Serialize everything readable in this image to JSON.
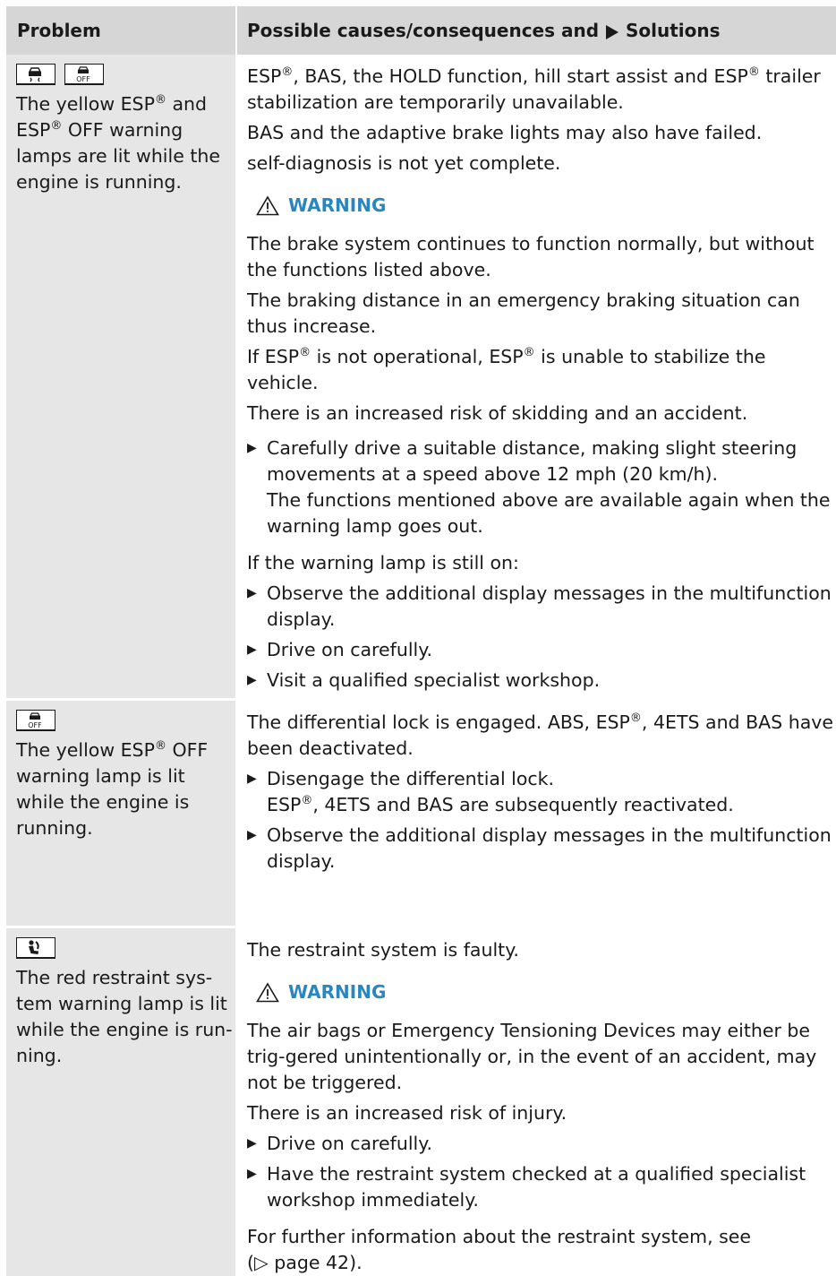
{
  "header": {
    "problem": "Problem",
    "solutions_prefix": "Possible causes/consequences and",
    "solutions_suffix": "Solutions"
  },
  "rows": [
    {
      "icons": [
        "esp-warning-lamp-icon",
        "esp-off-warning-lamp-icon"
      ],
      "problem": [
        "The yellow ESP",
        "®",
        " and ESP",
        "®",
        " OFF warning lamps are lit while the engine is running."
      ],
      "cause_1": [
        "ESP",
        "®",
        ", BAS, the HOLD function, hill start assist and ESP",
        "®",
        " trailer stabilization are temporarily unavailable."
      ],
      "cause_2": "BAS and the adaptive brake lights may also have failed.",
      "cause_3": "self-diagnosis is not yet complete.",
      "warning_label": "WARNING",
      "warning_1": "The brake system continues to function normally, but without the functions listed above.",
      "warning_2": "The braking distance in an emergency braking situation can thus increase.",
      "warning_3": [
        "If ESP",
        "®",
        " is not operational, ESP",
        "®",
        " is unable to stabilize the vehicle."
      ],
      "warning_4": "There is an increased risk of skidding and an accident.",
      "action_1": "Carefully drive a suitable distance, making slight steering movements at a speed above 12 mph (20 km/h).",
      "action_1_note": "The functions mentioned above are available again when the warning lamp goes out.",
      "if_still_on": "If the warning lamp is still on:",
      "action_2": "Observe the additional display messages in the multifunction display.",
      "action_3": "Drive on carefully.",
      "action_4": "Visit a qualified specialist workshop."
    },
    {
      "icons": [
        "esp-off-warning-lamp-icon"
      ],
      "problem": [
        "The yellow ESP",
        "®",
        " OFF warning lamp is lit while the engine is running."
      ],
      "cause_1": [
        "The differential lock is engaged. ABS, ESP",
        "®",
        ", 4ETS and BAS have been deactivated."
      ],
      "action_1": "Disengage the differential lock.",
      "action_1_note": [
        "ESP",
        "®",
        ", 4ETS and BAS are subsequently reactivated."
      ],
      "action_2": "Observe the additional display messages in the multifunction display."
    },
    {
      "icons": [
        "restraint-system-warning-lamp-icon"
      ],
      "problem": "The red restraint sys-tem warning lamp is lit while the engine is run-ning.",
      "cause_1": "The restraint system is faulty.",
      "warning_label": "WARNING",
      "warning_1": "The air bags or Emergency Tensioning Devices may either be trig-gered unintentionally or, in the event of an accident, may not be triggered.",
      "warning_2": "There is an increased risk of injury.",
      "action_1": "Drive on carefully.",
      "action_2": "Have the restraint system checked at a qualified specialist workshop immediately.",
      "further_info": "For further information about the restraint system, see",
      "page_ref": "(▷ page 42)."
    }
  ],
  "colors": {
    "header_bg": "#d6d6d6",
    "problem_bg": "#e6e6e6",
    "warning_blue": "#2a86c0"
  }
}
